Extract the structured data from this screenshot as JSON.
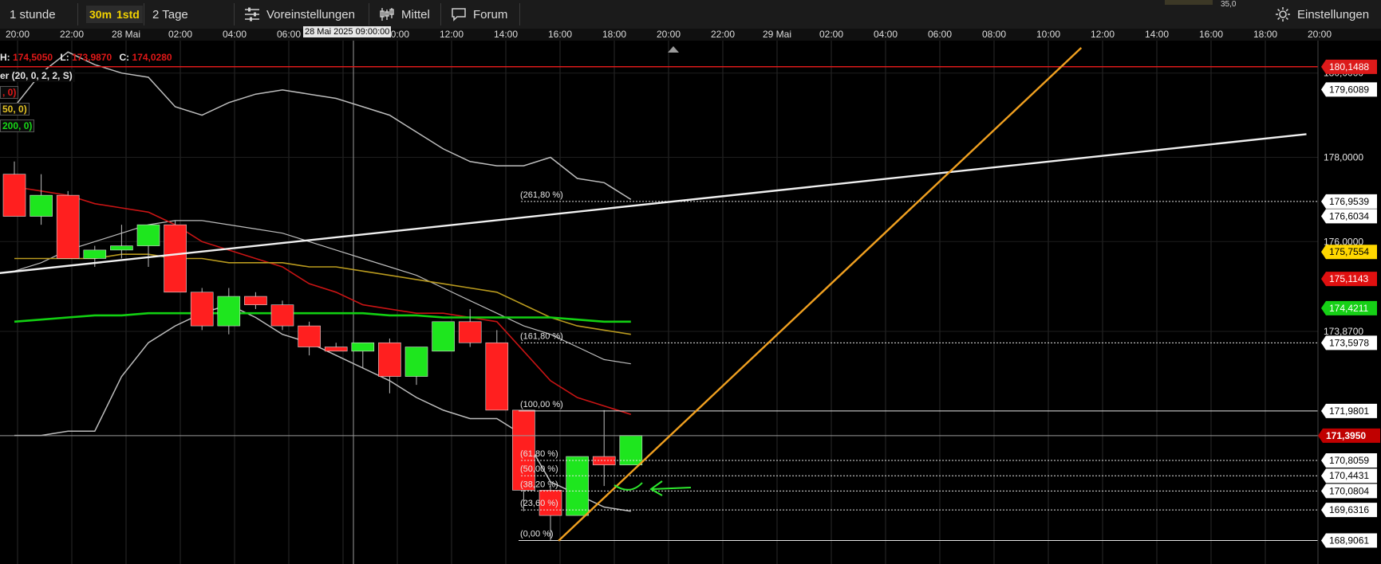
{
  "toolbar": {
    "timeframe_1": "1 stunde",
    "timeframe_2": "30m",
    "timeframe_3": "1std",
    "timeframe_4": "2 Tage",
    "presets": "Voreinstellungen",
    "indicator": "Mittel",
    "forum": "Forum",
    "settings": "Einstellungen",
    "corner_value": "35,0"
  },
  "ohlc": {
    "h_label": "H:",
    "h_value": "174,5050",
    "l_label": "L:",
    "l_value": "173,9870",
    "c_label": "C:",
    "c_value": "174,0280"
  },
  "indicators": {
    "bollinger": "er (20, 0, 2, 2, S)",
    "ma1": ", 0)",
    "ma2": "50, 0)",
    "ma3": "200, 0)"
  },
  "crosshair_time": "28 Mai 2025 09:00:00",
  "colors": {
    "bull": "#1ee61e",
    "bear": "#ff1f1f",
    "ma_red": "#c81414",
    "ma_yellow": "#b99a1e",
    "ma_green": "#12d012",
    "bands": "#bdbdbd",
    "trend_orange": "#f0a020",
    "trend_white": "#f0f0f0",
    "ref_red": "#dc1a1a",
    "current_badge": "#c00000",
    "yellow_badge": "#ffd700",
    "red_badge": "#e01010",
    "green_badge": "#16d016",
    "annotation": "#2ee62e"
  },
  "chart_data": {
    "type": "candlestick",
    "interval": "1 stunde",
    "time_ticks": [
      "20:00",
      "22:00",
      "28 Mai",
      "02:00",
      "04:00",
      "06:00",
      "08:00",
      "10:00",
      "12:00",
      "14:00",
      "16:00",
      "18:00",
      "20:00",
      "22:00",
      "29 Mai",
      "02:00",
      "04:00",
      "06:00",
      "08:00",
      "10:00",
      "12:00",
      "14:00",
      "16:00",
      "18:00",
      "20:00"
    ],
    "ylim": [
      168.5,
      180.6
    ],
    "price_ticks": [
      {
        "label": "180,0000",
        "value": 180.0
      },
      {
        "label": "178,0000",
        "value": 178.0
      },
      {
        "label": "176,0000",
        "value": 176.0
      },
      {
        "label": "173,8700",
        "value": 173.87
      }
    ],
    "price_badges": [
      {
        "label": "180,1488",
        "value": 180.1488,
        "style": "red-fill"
      },
      {
        "label": "179,6089",
        "value": 179.6089,
        "style": "white"
      },
      {
        "label": "176,9539",
        "value": 176.9539,
        "style": "white"
      },
      {
        "label": "176,6034",
        "value": 176.6034,
        "style": "white"
      },
      {
        "label": "175,7554",
        "value": 175.7554,
        "style": "yellow"
      },
      {
        "label": "175,1143",
        "value": 175.1143,
        "style": "red"
      },
      {
        "label": "174,4211",
        "value": 174.4211,
        "style": "green"
      },
      {
        "label": "173,5978",
        "value": 173.5978,
        "style": "white"
      },
      {
        "label": "171,9801",
        "value": 171.9801,
        "style": "white"
      },
      {
        "label": "171,3950",
        "value": 171.395,
        "style": "current"
      },
      {
        "label": "170,8059",
        "value": 170.8059,
        "style": "white"
      },
      {
        "label": "170,4431",
        "value": 170.4431,
        "style": "white"
      },
      {
        "label": "170,0804",
        "value": 170.0804,
        "style": "white"
      },
      {
        "label": "169,6316",
        "value": 169.6316,
        "style": "white"
      },
      {
        "label": "168,9061",
        "value": 168.9061,
        "style": "white"
      }
    ],
    "fibonacci": [
      {
        "label": "(261,80 %)",
        "value": 176.9539
      },
      {
        "label": "(161,80 %)",
        "value": 173.5978
      },
      {
        "label": "(100,00 %)",
        "value": 171.9801
      },
      {
        "label": "(61,80 %)",
        "value": 170.8059
      },
      {
        "label": "(50,00 %)",
        "value": 170.4431
      },
      {
        "label": "(38,20 %)",
        "value": 170.0804
      },
      {
        "label": "(23,60 %)",
        "value": 169.6316
      },
      {
        "label": "(0,00 %)",
        "value": 168.9061
      }
    ],
    "candles": [
      {
        "o": 177.6,
        "h": 177.9,
        "l": 176.6,
        "c": 176.6
      },
      {
        "o": 176.6,
        "h": 177.6,
        "l": 176.4,
        "c": 177.1
      },
      {
        "o": 177.1,
        "h": 177.2,
        "l": 175.6,
        "c": 175.6
      },
      {
        "o": 175.6,
        "h": 175.9,
        "l": 175.4,
        "c": 175.8
      },
      {
        "o": 175.8,
        "h": 176.4,
        "l": 175.6,
        "c": 175.9
      },
      {
        "o": 175.9,
        "h": 176.4,
        "l": 175.4,
        "c": 176.4
      },
      {
        "o": 176.4,
        "h": 176.5,
        "l": 174.8,
        "c": 174.8
      },
      {
        "o": 174.8,
        "h": 174.9,
        "l": 173.9,
        "c": 174.0
      },
      {
        "o": 174.0,
        "h": 174.9,
        "l": 173.8,
        "c": 174.7
      },
      {
        "o": 174.7,
        "h": 174.8,
        "l": 174.4,
        "c": 174.5
      },
      {
        "o": 174.5,
        "h": 174.6,
        "l": 173.9,
        "c": 174.0
      },
      {
        "o": 174.0,
        "h": 174.1,
        "l": 173.3,
        "c": 173.5
      },
      {
        "o": 173.5,
        "h": 173.6,
        "l": 173.4,
        "c": 173.4
      },
      {
        "o": 173.4,
        "h": 173.6,
        "l": 173.0,
        "c": 173.6
      },
      {
        "o": 173.6,
        "h": 173.7,
        "l": 172.4,
        "c": 172.8
      },
      {
        "o": 172.8,
        "h": 173.5,
        "l": 172.6,
        "c": 173.5
      },
      {
        "o": 173.4,
        "h": 174.1,
        "l": 173.4,
        "c": 174.1
      },
      {
        "o": 174.1,
        "h": 174.4,
        "l": 173.5,
        "c": 173.6
      },
      {
        "o": 173.6,
        "h": 173.9,
        "l": 172.0,
        "c": 172.0
      },
      {
        "o": 172.0,
        "h": 172.0,
        "l": 169.6,
        "c": 170.1
      },
      {
        "o": 170.1,
        "h": 170.2,
        "l": 168.9,
        "c": 169.5
      },
      {
        "o": 169.5,
        "h": 170.9,
        "l": 169.5,
        "c": 170.9
      },
      {
        "o": 170.9,
        "h": 172.0,
        "l": 170.2,
        "c": 170.7
      },
      {
        "o": 170.7,
        "h": 171.4,
        "l": 170.7,
        "c": 171.4
      }
    ],
    "series": [
      {
        "name": "Bollinger upper",
        "values": [
          179.2,
          180.0,
          180.5,
          180.2,
          180.0,
          179.9,
          179.2,
          179.0,
          179.3,
          179.5,
          179.6,
          179.5,
          179.4,
          179.2,
          179.0,
          178.6,
          178.2,
          177.9,
          177.8,
          177.8,
          178.0,
          177.5,
          177.4,
          177.0
        ]
      },
      {
        "name": "Bollinger middle",
        "values": [
          175.3,
          175.5,
          175.8,
          176.0,
          176.2,
          176.4,
          176.5,
          176.5,
          176.4,
          176.3,
          176.2,
          176.0,
          175.8,
          175.6,
          175.4,
          175.2,
          174.9,
          174.6,
          174.3,
          174.0,
          173.8,
          173.5,
          173.2,
          173.1
        ]
      },
      {
        "name": "Bollinger lower",
        "values": [
          171.4,
          171.4,
          171.5,
          171.5,
          172.8,
          173.6,
          174.0,
          174.3,
          174.5,
          174.2,
          173.8,
          173.6,
          173.3,
          173.0,
          172.7,
          172.3,
          172.0,
          171.8,
          171.8,
          171.4,
          170.3,
          170.0,
          169.7,
          169.6
        ]
      },
      {
        "name": "MA 20",
        "values": [
          177.3,
          177.2,
          177.1,
          176.9,
          176.8,
          176.7,
          176.4,
          176.0,
          175.8,
          175.6,
          175.4,
          175.0,
          174.8,
          174.5,
          174.4,
          174.3,
          174.3,
          174.2,
          174.1,
          173.4,
          172.7,
          172.3,
          172.1,
          171.9
        ]
      },
      {
        "name": "MA 50",
        "values": [
          175.6,
          175.6,
          175.6,
          175.6,
          175.7,
          175.7,
          175.6,
          175.6,
          175.5,
          175.5,
          175.5,
          175.4,
          175.4,
          175.3,
          175.2,
          175.1,
          175.0,
          174.9,
          174.8,
          174.5,
          174.2,
          174.0,
          173.9,
          173.8
        ]
      },
      {
        "name": "MA 200",
        "values": [
          174.1,
          174.15,
          174.2,
          174.25,
          174.25,
          174.3,
          174.3,
          174.3,
          174.3,
          174.3,
          174.3,
          174.3,
          174.3,
          174.3,
          174.25,
          174.25,
          174.2,
          174.2,
          174.2,
          174.2,
          174.2,
          174.15,
          174.1,
          174.1
        ]
      }
    ],
    "trendlines": [
      {
        "name": "white",
        "p1": {
          "bar": -0.6,
          "price": 175.25
        },
        "p2": {
          "bar": 48.2,
          "price": 178.55
        }
      },
      {
        "name": "orange",
        "p1": {
          "bar": 20.3,
          "price": 168.9
        },
        "p2": {
          "bar": 39.8,
          "price": 180.6
        }
      }
    ],
    "reference_line": {
      "name": "red",
      "value": 180.15
    },
    "current_price": 171.395
  }
}
